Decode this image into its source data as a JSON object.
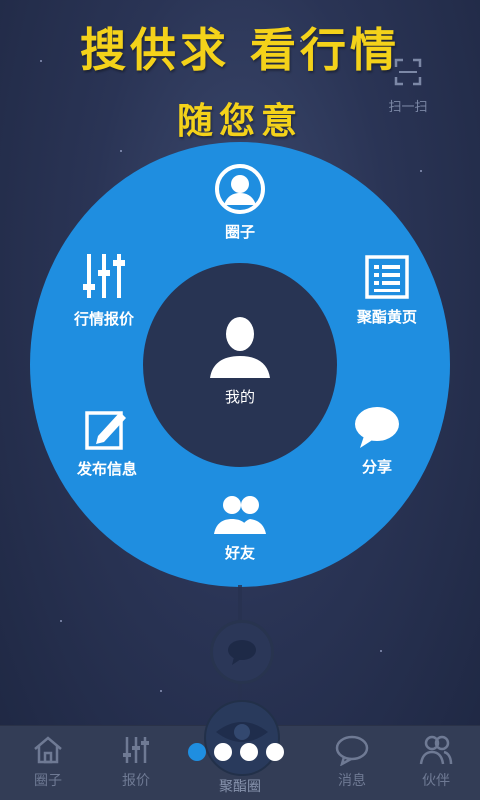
{
  "header": {
    "line1": "搜供求  看行情",
    "line2": "随您意",
    "scan_label": "扫一扫"
  },
  "wheel": {
    "center_label": "我的",
    "items": [
      {
        "label": "圈子",
        "icon": "user-circle-icon"
      },
      {
        "label": "聚酯黄页",
        "icon": "list-page-icon"
      },
      {
        "label": "分享",
        "icon": "speech-bubble-icon"
      },
      {
        "label": "好友",
        "icon": "friends-icon"
      },
      {
        "label": "发布信息",
        "icon": "edit-icon"
      },
      {
        "label": "行情报价",
        "icon": "sliders-icon"
      }
    ]
  },
  "page_indicator": {
    "count": 4,
    "active_index": 0
  },
  "tabs": [
    {
      "label": "圈子",
      "icon": "home-icon"
    },
    {
      "label": "报价",
      "icon": "sliders-icon"
    },
    {
      "label": "聚酯圈",
      "icon": "eye-icon",
      "active": true
    },
    {
      "label": "消息",
      "icon": "message-icon"
    },
    {
      "label": "伙伴",
      "icon": "partners-icon"
    }
  ],
  "colors": {
    "accent": "#1f8ee0",
    "headline": "#f4d21a",
    "background": "#2a3455",
    "tabbar": "#333d56"
  }
}
